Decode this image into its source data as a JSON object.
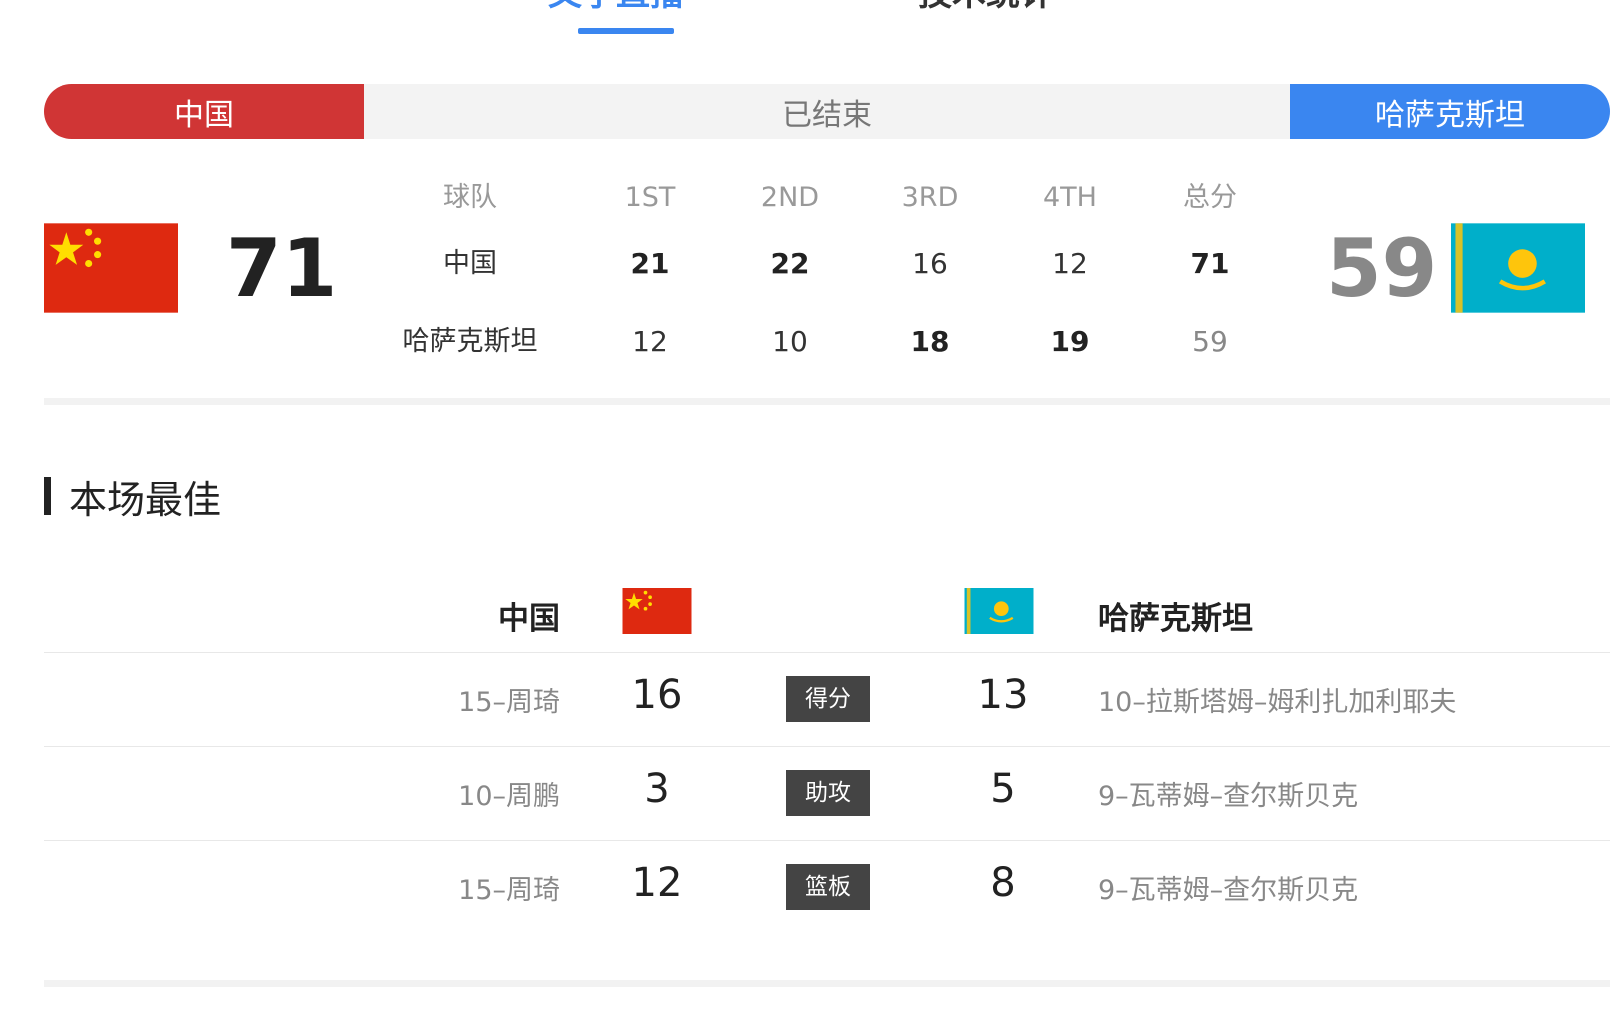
{
  "tabs": {
    "live": "文字直播",
    "stats": "技术统计"
  },
  "banner": {
    "home": "中国",
    "status": "已结束",
    "away": "哈萨克斯坦"
  },
  "score": {
    "home": "71",
    "away": "59"
  },
  "quarters": {
    "headers": [
      "球队",
      "1ST",
      "2ND",
      "3RD",
      "4TH",
      "总分"
    ],
    "rows": [
      {
        "team": "中国",
        "q1": "21",
        "q2": "22",
        "q3": "16",
        "q4": "12",
        "total": "71"
      },
      {
        "team": "哈萨克斯坦",
        "q1": "12",
        "q2": "10",
        "q3": "18",
        "q4": "19",
        "total": "59"
      }
    ]
  },
  "best": {
    "title": "本场最佳",
    "home_team": "中国",
    "away_team": "哈萨克斯坦",
    "rows": [
      {
        "home_player": "15–周琦",
        "home_value": "16",
        "category": "得分",
        "away_value": "13",
        "away_player": "10–拉斯塔姆–姆利扎加利耶夫"
      },
      {
        "home_player": "10–周鹏",
        "home_value": "3",
        "category": "助攻",
        "away_value": "5",
        "away_player": "9–瓦蒂姆–查尔斯贝克"
      },
      {
        "home_player": "15–周琦",
        "home_value": "12",
        "category": "篮板",
        "away_value": "8",
        "away_player": "9–瓦蒂姆–查尔斯贝克"
      }
    ]
  },
  "colors": {
    "home": "#d03535",
    "away": "#3a86f0",
    "china_flag": "#de2910",
    "kaz_flag": "#00afca",
    "gold": "#fec50c"
  },
  "icons": {
    "home_flag": "china-flag-icon",
    "away_flag": "kazakhstan-flag-icon"
  }
}
